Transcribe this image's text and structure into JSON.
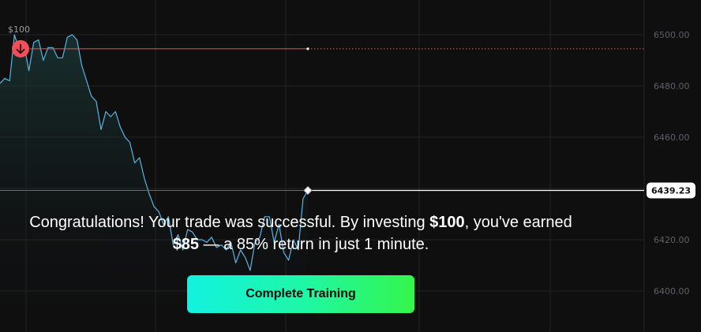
{
  "chart_data": {
    "type": "line",
    "y_ticks": [
      "6500.00",
      "6480.00",
      "6460.00",
      "6440.00",
      "6420.00",
      "6400.00"
    ],
    "ylim": [
      6393,
      6506
    ],
    "grid": true,
    "entry_price": 6494.5,
    "entry_label": "$100",
    "current_price": 6439.23,
    "current_price_label": "6439.23",
    "values": [
      6481,
      6483,
      6482,
      6500,
      6494,
      6496,
      6486,
      6497,
      6498,
      6490,
      6495,
      6495,
      6491,
      6491,
      6499,
      6500,
      6498,
      6488,
      6482,
      6476,
      6474,
      6463,
      6470,
      6468,
      6470,
      6464,
      6460,
      6458,
      6450,
      6452,
      6444,
      6438,
      6433,
      6431,
      6426,
      6429,
      6418,
      6422,
      6416,
      6424,
      6423,
      6420,
      6420,
      6419,
      6421,
      6417,
      6418,
      6416,
      6419,
      6411,
      6416,
      6413,
      6408,
      6419,
      6421,
      6429,
      6429,
      6419,
      6426,
      6415,
      6412,
      6420,
      6416,
      6436,
      6439.23
    ],
    "colors": {
      "line": "#5bb4e6",
      "entry_line": "#e05a5a",
      "entry_marker": "#f24f5b",
      "current_line": "#ffffff",
      "grid": "#222326"
    }
  },
  "message": {
    "part1": "Congratulations! Your trade was successful. By investing ",
    "amount": "$100",
    "part2": ", you've earned",
    "earned": "$85",
    "part3": " — a 85% return in just 1 minute."
  },
  "button": {
    "label": "Complete Training"
  },
  "icons": {
    "entry_marker": "arrow-down-icon"
  }
}
